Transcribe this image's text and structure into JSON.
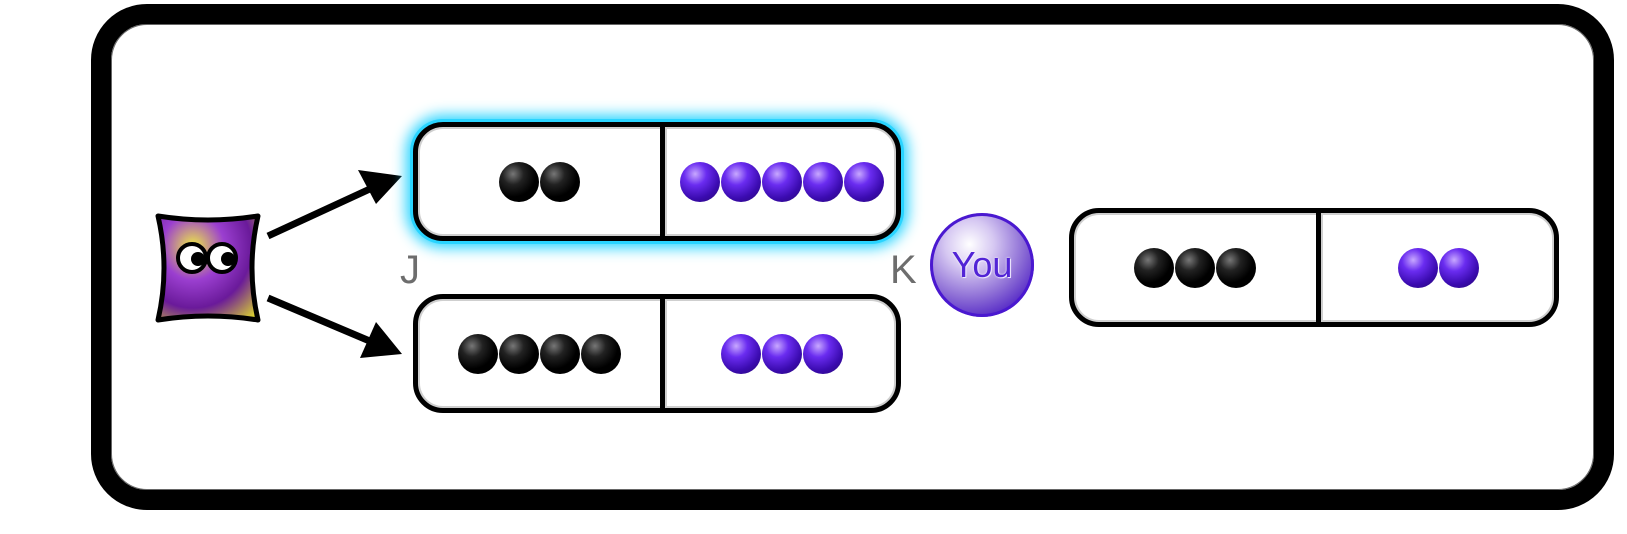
{
  "labels": {
    "j": "J",
    "k": "K"
  },
  "player": {
    "label": "You"
  },
  "colors": {
    "black_dot": "#000000",
    "purple_dot": "#5a1fe0",
    "highlight": "#29d4ff"
  },
  "character": {
    "icon": "purple-yellow-creature-with-eyes"
  },
  "cards": {
    "option_j": {
      "black": 2,
      "purple": 5,
      "highlighted": true
    },
    "option_k": {
      "black": 4,
      "purple": 3,
      "highlighted": false
    },
    "player_card": {
      "black": 3,
      "purple": 2
    }
  }
}
